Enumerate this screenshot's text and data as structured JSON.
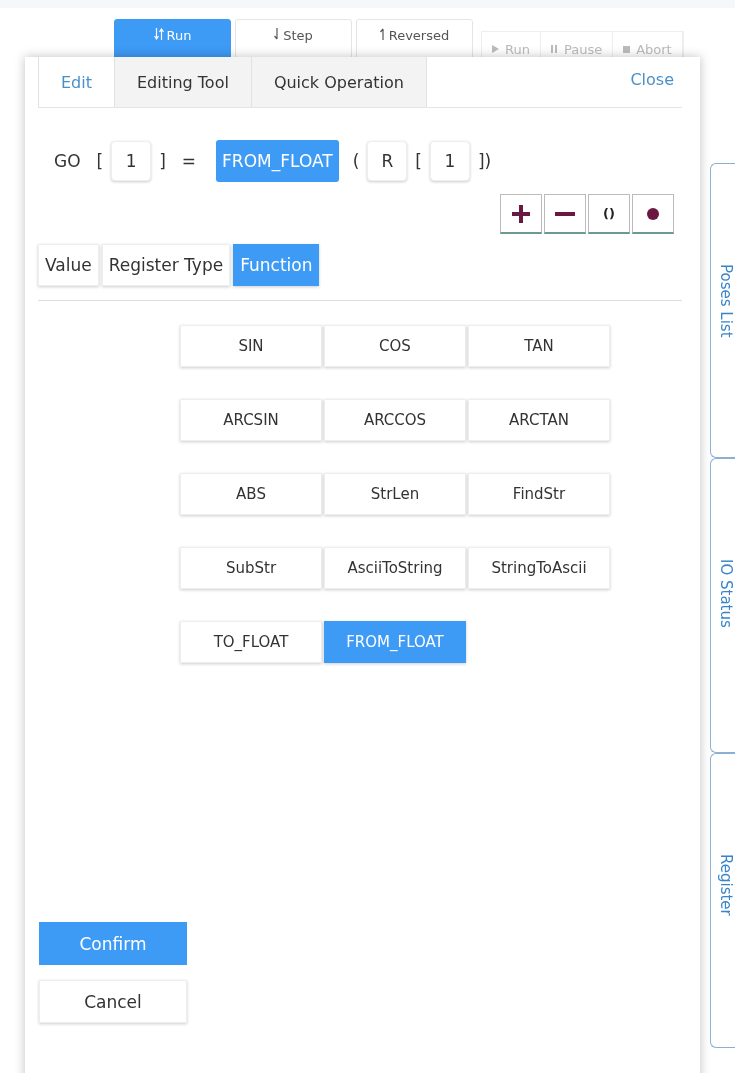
{
  "toolbar": {
    "mode_buttons": [
      {
        "kind": "run",
        "label": "Run",
        "selected": true
      },
      {
        "kind": "step",
        "label": "Step",
        "selected": false
      },
      {
        "kind": "reverse",
        "label": "Reversed",
        "selected": false
      }
    ],
    "controls": [
      {
        "kind": "play",
        "label": "Run"
      },
      {
        "kind": "pause",
        "label": "Pause"
      },
      {
        "kind": "stop",
        "label": "Abort"
      }
    ]
  },
  "dialog": {
    "tabs": [
      {
        "label": "Edit",
        "selected": true
      },
      {
        "label": "Editing Tool",
        "selected": false
      },
      {
        "label": "Quick Operation",
        "selected": false
      }
    ],
    "close": "Close",
    "expression": [
      {
        "kind": "text",
        "text": "GO"
      },
      {
        "kind": "text",
        "text": "["
      },
      {
        "kind": "field",
        "text": "1"
      },
      {
        "kind": "text",
        "text": "]"
      },
      {
        "kind": "text",
        "text": "="
      },
      {
        "kind": "function",
        "text": "FROM_FLOAT"
      },
      {
        "kind": "text",
        "text": "("
      },
      {
        "kind": "field",
        "text": "R"
      },
      {
        "kind": "text",
        "text": "["
      },
      {
        "kind": "field",
        "text": "1"
      },
      {
        "kind": "text",
        "text": "])"
      }
    ],
    "operators": [
      {
        "kind": "plus"
      },
      {
        "kind": "minus"
      },
      {
        "kind": "text",
        "text": "()"
      },
      {
        "kind": "dot"
      }
    ],
    "types": [
      {
        "label": "Value",
        "selected": false
      },
      {
        "label": "Register Type",
        "selected": false
      },
      {
        "label": "Function",
        "selected": true
      }
    ],
    "functions": [
      {
        "label": "SIN",
        "selected": false
      },
      {
        "label": "COS",
        "selected": false
      },
      {
        "label": "TAN",
        "selected": false
      },
      {
        "label": "ARCSIN",
        "selected": false
      },
      {
        "label": "ARCCOS",
        "selected": false
      },
      {
        "label": "ARCTAN",
        "selected": false
      },
      {
        "label": "ABS",
        "selected": false
      },
      {
        "label": "StrLen",
        "selected": false
      },
      {
        "label": "FindStr",
        "selected": false
      },
      {
        "label": "SubStr",
        "selected": false
      },
      {
        "label": "AsciiToString",
        "selected": false
      },
      {
        "label": "StringToAscii",
        "selected": false
      },
      {
        "label": "TO_FLOAT",
        "selected": false
      },
      {
        "label": "FROM_FLOAT",
        "selected": true
      }
    ],
    "confirm": "Confirm",
    "cancel": "Cancel"
  },
  "side_tabs": [
    "Poses List",
    "IO Status",
    "Register"
  ]
}
